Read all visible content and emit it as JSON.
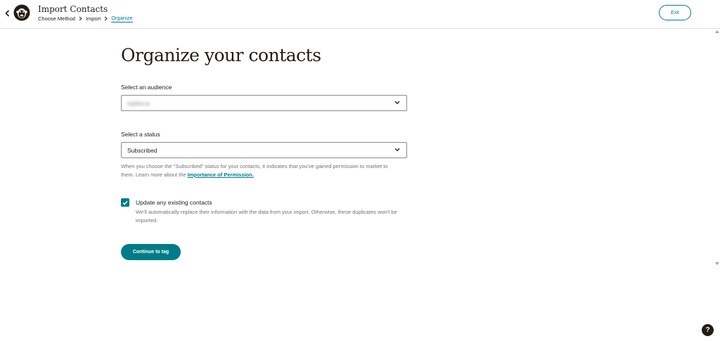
{
  "header": {
    "title": "Import Contacts",
    "breadcrumb": [
      "Choose Method",
      "Import",
      "Organize"
    ],
    "exit_label": "Exit"
  },
  "main": {
    "title": "Organize your contacts",
    "audience": {
      "label": "Select an audience",
      "value": "nasha.io"
    },
    "status": {
      "label": "Select a status",
      "value": "Subscribed",
      "help_text": "When you choose the \"Subscribed\" status for your contacts, it indicates that you've gained permission to market to them. Learn more about the ",
      "help_link": "Importance of Permission."
    },
    "update_existing": {
      "checked": true,
      "label": "Update any existing contacts",
      "description": "We'll automatically replace their information with the data from your import. Otherwise, these duplicates won't be imported."
    },
    "continue_label": "Continue to tag"
  },
  "help_fab": "?",
  "colors": {
    "accent": "#007c89",
    "text": "#241c15",
    "muted": "#727272"
  },
  "icons": [
    "back-arrow-icon",
    "mailchimp-logo-icon",
    "chevron-right-icon",
    "chevron-down-icon",
    "checkmark-icon",
    "help-icon"
  ]
}
